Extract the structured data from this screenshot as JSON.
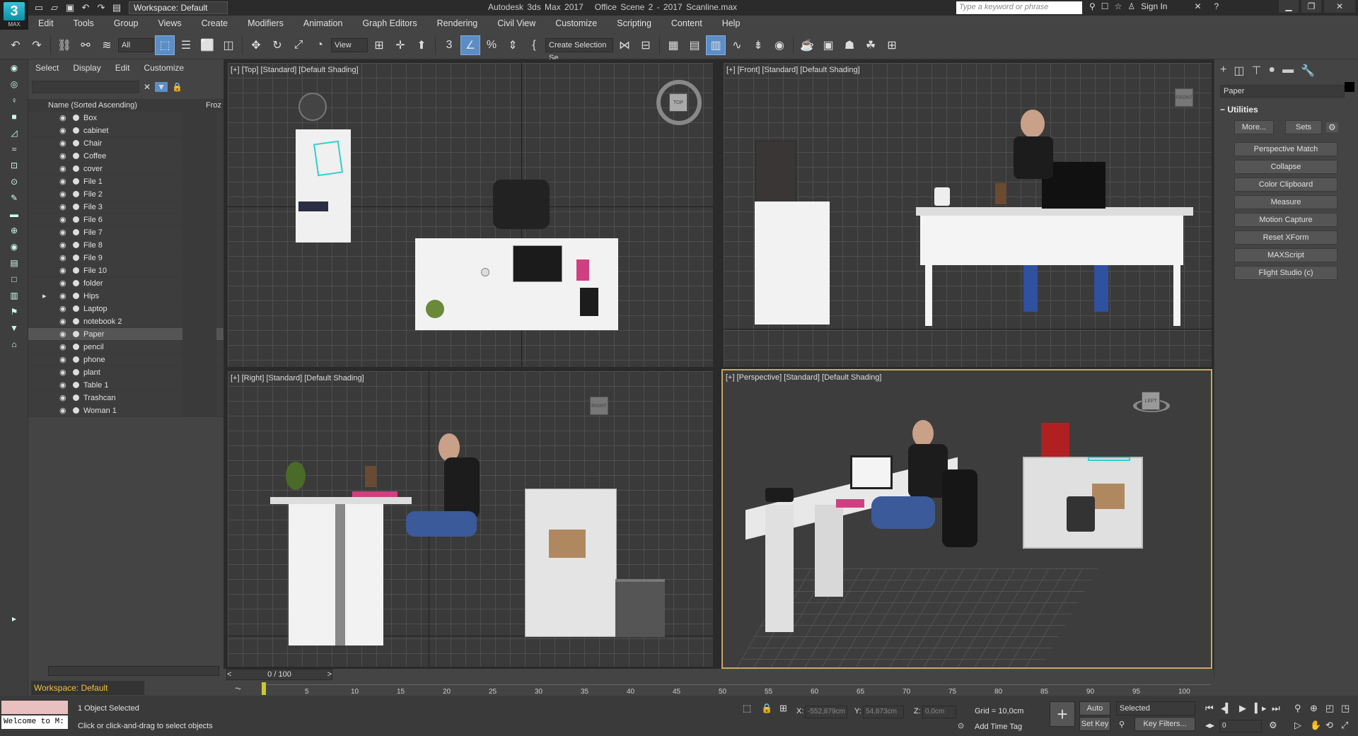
{
  "app": {
    "title": "Autodesk 3ds Max 2017",
    "file": "Office Scene 2 - 2017 Scanline.max",
    "logo_text": "3",
    "logo_sub": "MAX",
    "workspace": "Workspace: Default",
    "search_placeholder": "Type a keyword or phrase",
    "sign_in": "Sign In"
  },
  "menu": [
    "Edit",
    "Tools",
    "Group",
    "Views",
    "Create",
    "Modifiers",
    "Animation",
    "Graph Editors",
    "Rendering",
    "Civil View",
    "Customize",
    "Scripting",
    "Content",
    "Help"
  ],
  "toolbar": {
    "filter_all": "All",
    "ref_coord": "View",
    "selection_set": "Create Selection Se"
  },
  "scene_explorer": {
    "tabs": [
      "Select",
      "Display",
      "Edit",
      "Customize"
    ],
    "column_name": "Name (Sorted Ascending)",
    "column_frozen": "Froz",
    "items": [
      "Box",
      "cabinet",
      "Chair",
      "Coffee",
      "cover",
      "File 1",
      "File 2",
      "File 3",
      "File 6",
      "File 7",
      "File 8",
      "File 9",
      "File 10",
      "folder",
      "Hips",
      "Laptop",
      "notebook 2",
      "Paper",
      "pencil",
      "phone",
      "plant",
      "Table 1",
      "Trashcan",
      "Woman 1"
    ],
    "selected": "Paper",
    "workspace_bottom": "Workspace: Default"
  },
  "viewports": {
    "top": "[+] [Top] [Standard] [Default Shading]",
    "front": "[+] [Front] [Standard] [Default Shading]",
    "right": "[+] [Right] [Standard] [Default Shading]",
    "perspective": "[+] [Perspective] [Standard] [Default Shading]"
  },
  "command_panel": {
    "object_name": "Paper",
    "rollout": "Utilities",
    "more": "More...",
    "sets": "Sets",
    "buttons": [
      "Perspective Match",
      "Collapse",
      "Color Clipboard",
      "Measure",
      "Motion Capture",
      "Reset XForm",
      "MAXScript",
      "Flight Studio (c)"
    ]
  },
  "timeline": {
    "frame": "0 / 100",
    "ticks": [
      "5",
      "10",
      "15",
      "20",
      "25",
      "30",
      "35",
      "40",
      "45",
      "50",
      "55",
      "60",
      "65",
      "70",
      "75",
      "80",
      "85",
      "90",
      "95",
      "100"
    ]
  },
  "status": {
    "listener": "Welcome to M:",
    "selected": "1 Object Selected",
    "prompt": "Click or click-and-drag to select objects",
    "x_label": "X:",
    "x_value": "-552,879cm",
    "y_label": "Y:",
    "y_value": "54,873cm",
    "z_label": "Z:",
    "z_value": "0,0cm",
    "grid": "Grid = 10,0cm",
    "add_time_tag": "Add Time Tag",
    "auto_key": "Auto Key",
    "set_key": "Set Key",
    "selected_dd": "Selected",
    "key_filters": "Key Filters...",
    "frame_value": "0"
  }
}
